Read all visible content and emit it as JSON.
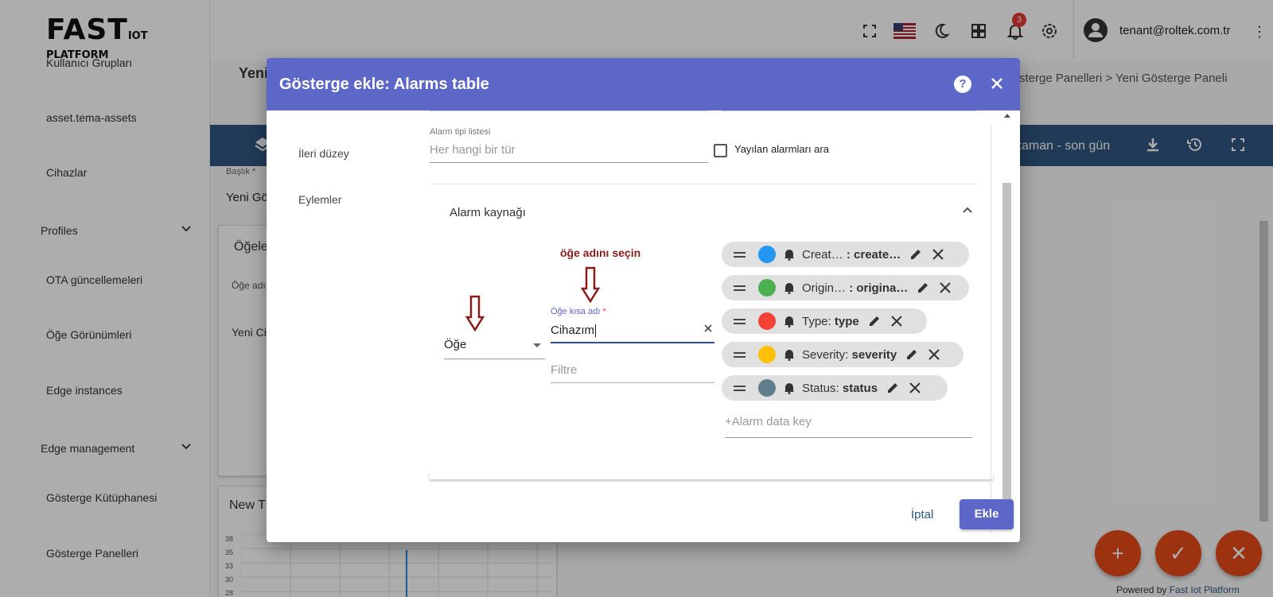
{
  "sidebar": {
    "logo_big": "FAST",
    "logo_small": "IOT PLATFORM",
    "items": {
      "user_groups": "Kullanıcı Grupları",
      "assets": "asset.tema-assets",
      "devices": "Cihazlar",
      "profiles": "Profiles",
      "ota": "OTA güncellemeleri",
      "entity_views": "Öğe Görünümleri",
      "edge_instances": "Edge instances",
      "edge_management": "Edge management",
      "widget_library": "Gösterge Kütüphanesi",
      "dashboards": "Gösterge Panelleri"
    }
  },
  "topbar": {
    "notification_count": "3",
    "user_email": "tenant@roltek.com.tr"
  },
  "breadcrumb": {
    "path": "sterge Panelleri  >  Yeni Gösterge Paneli",
    "page_title": "Yeni"
  },
  "toolbar": {
    "time_window": "zaman - son gün"
  },
  "background": {
    "title_label": "Başlık *",
    "title_value": "Yeni Gö",
    "entities_card_title": "Öğele",
    "entity_name_col": "Öğe adı",
    "entity_row": "Yeni Cih",
    "chart_card_title": "New T",
    "chart_ticks": [
      "38",
      "35",
      "33",
      "30",
      "28"
    ]
  },
  "dialog": {
    "title": "Gösterge ekle: Alarms table",
    "help_label": "?",
    "nav": {
      "advanced": "İleri düzey",
      "actions": "Eylemler"
    },
    "alarm_type_list_label": "Alarm tipi listesi",
    "alarm_type_placeholder": "Her hangi bir tür",
    "search_propagated_label": "Yayılan alarmları ara",
    "alarm_source_title": "Alarm kaynağı",
    "annotation": "öğe adını seçin",
    "entity_type_value": "Öğe",
    "entity_alias_label": "Öğe kısa adı",
    "entity_alias_required": "*",
    "entity_alias_value": "Cihazım",
    "filter_placeholder": "Filtre",
    "data_keys": [
      {
        "label": "Creat…",
        "value": ": create…",
        "color": "#2196f3"
      },
      {
        "label": "Origin…",
        "value": ": origina…",
        "color": "#4caf50"
      },
      {
        "label": "Type:",
        "value": "type",
        "color": "#f44336"
      },
      {
        "label": "Severity:",
        "value": "severity",
        "color": "#ffc107"
      },
      {
        "label": "Status:",
        "value": "status",
        "color": "#607d8b"
      }
    ],
    "add_key_placeholder": "+Alarm data key",
    "cancel_label": "İptal",
    "add_label": "Ekle"
  },
  "fab": {
    "add": "+",
    "confirm": "✓",
    "close": "✕"
  },
  "footer": {
    "powered_prefix": "Powered by",
    "powered_brand": "Fast Iot Platform"
  }
}
